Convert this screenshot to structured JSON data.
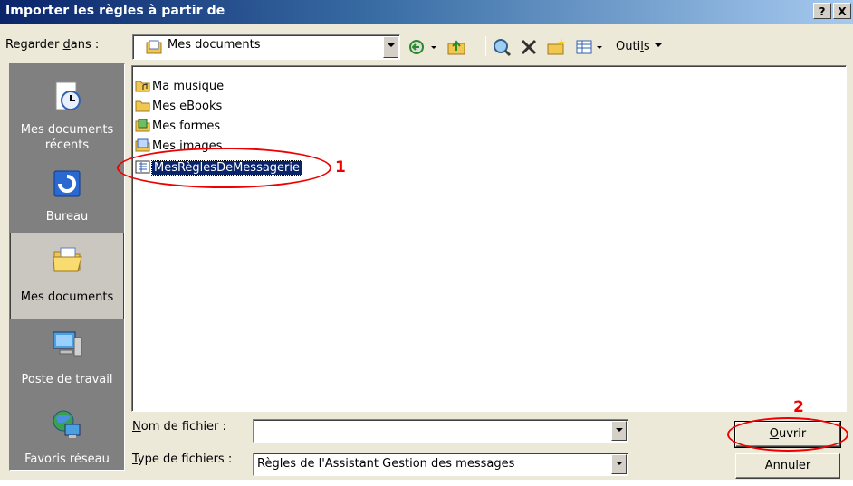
{
  "window": {
    "title": "Importer les règles à partir de"
  },
  "titlebar_buttons": {
    "help": "?",
    "close": "X"
  },
  "lookin": {
    "label_pre": "Regarder ",
    "label_acc": "d",
    "label_post": "ans :",
    "value": "Mes documents"
  },
  "toolbar": {
    "tools_pre": "Outi",
    "tools_acc": "l",
    "tools_post": "s"
  },
  "places": [
    {
      "label": "Mes documents récents",
      "icon": "clock-document-icon",
      "selected": false
    },
    {
      "label": "Bureau",
      "icon": "desktop-icon",
      "selected": false
    },
    {
      "label": "Mes documents",
      "icon": "open-folder-icon",
      "selected": true
    },
    {
      "label": "Poste de travail",
      "icon": "computer-icon",
      "selected": false
    },
    {
      "label": "Favoris réseau",
      "icon": "network-globe-icon",
      "selected": false
    }
  ],
  "files": [
    {
      "name": "Ma musique",
      "icon": "music-folder-icon",
      "selected": false
    },
    {
      "name": "Mes eBooks",
      "icon": "folder-icon",
      "selected": false
    },
    {
      "name": "Mes formes",
      "icon": "shapes-folder-icon",
      "selected": false
    },
    {
      "name": "Mes images",
      "icon": "images-folder-icon",
      "selected": false
    },
    {
      "name": "MesRèglesDeMessagerie",
      "icon": "rules-file-icon",
      "selected": true
    }
  ],
  "filename": {
    "label_acc": "N",
    "label_post": "om de fichier :",
    "value": ""
  },
  "filetype": {
    "label_acc": "T",
    "label_post": "ype de fichiers :",
    "value": "Règles de l'Assistant Gestion des messages"
  },
  "buttons": {
    "open_acc": "O",
    "open_post": "uvrir",
    "cancel": "Annuler"
  },
  "annotations": {
    "step1": "1",
    "step2": "2"
  },
  "colors": {
    "selection": "#0A246A",
    "annotation": "#e00000",
    "titlebar": "#0A246A"
  }
}
